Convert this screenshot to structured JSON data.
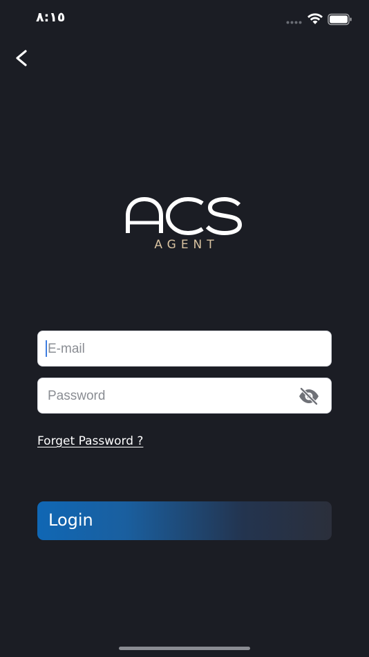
{
  "status_bar": {
    "time": "٨:١٥",
    "icons": [
      "signal-dots-icon",
      "wifi-icon",
      "battery-icon"
    ]
  },
  "nav": {
    "back_icon": "chevron-left-icon"
  },
  "logo": {
    "mark": "ACS",
    "subtitle": "AGENT",
    "subtitle_color": "#d9c3a1"
  },
  "form": {
    "email": {
      "value": "",
      "placeholder": "E-mail"
    },
    "password": {
      "value": "",
      "placeholder": "Password",
      "visibility_icon": "eye-off-icon"
    },
    "forget_password_label": "Forget Password ?",
    "login_label": "Login"
  },
  "colors": {
    "background": "#1b1d24",
    "accent": "#1067b4",
    "caret": "#3d7de0"
  }
}
